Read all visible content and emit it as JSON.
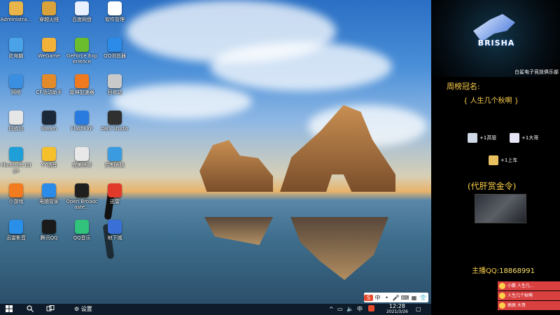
{
  "desktop_icons": [
    {
      "label": "Administra...",
      "color": "#e8b54a"
    },
    {
      "label": "穿越火线",
      "color": "#d9a23a"
    },
    {
      "label": "百度网盘",
      "color": "#e9f0ff"
    },
    {
      "label": "软件管理",
      "color": "#ffffff"
    },
    {
      "label": "此电脑",
      "color": "#4aa3e8"
    },
    {
      "label": "WeGame",
      "color": "#f2b23a"
    },
    {
      "label": "GeForce Experience",
      "color": "#6bbd2e"
    },
    {
      "label": "QQ浏览器",
      "color": "#2c8be8"
    },
    {
      "label": "网络",
      "color": "#3a8fe0"
    },
    {
      "label": "CF活动助手",
      "color": "#e38a2a"
    },
    {
      "label": "雷神加速器",
      "color": "#f07a1f"
    },
    {
      "label": "回收站",
      "color": "#c9c9c9"
    },
    {
      "label": "回收站",
      "color": "#e6e6e6"
    },
    {
      "label": "Steam",
      "color": "#1b2838"
    },
    {
      "label": "FlashFXP",
      "color": "#2a7be0"
    },
    {
      "label": "OBS Studio",
      "color": "#303030"
    },
    {
      "label": "Microsoft Edge",
      "color": "#1f9fd8"
    },
    {
      "label": "YY语音",
      "color": "#f5c02a"
    },
    {
      "label": "完美世界",
      "color": "#e8e8e8"
    },
    {
      "label": "控制面板",
      "color": "#3a9be0"
    },
    {
      "label": "小游戏",
      "color": "#f27b1f"
    },
    {
      "label": "电脑管家",
      "color": "#2a8be8"
    },
    {
      "label": "Open Broadcaste...",
      "color": "#1f1f1f"
    },
    {
      "label": "迅雷",
      "color": "#e23a2a"
    },
    {
      "label": "迅雷影音",
      "color": "#2a8fe8"
    },
    {
      "label": "腾讯QQ",
      "color": "#1a1a1a"
    },
    {
      "label": "QQ音乐",
      "color": "#31c27c"
    },
    {
      "label": "地下城",
      "color": "#3a6fd8"
    }
  ],
  "taskbar": {
    "start_icon": "windows-logo-icon",
    "search_icon": "search-icon",
    "taskview_icon": "task-view-icon",
    "settings_label": "设置",
    "tray_up": "^",
    "ime_lang": "中",
    "time": "12:28",
    "date": "2021/3/26"
  },
  "ime_bar": {
    "items": [
      "S",
      "中",
      "•",
      "🎤",
      "⌨",
      "▦",
      "👕"
    ]
  },
  "side_panel": {
    "club_name": "白鲨电子竞技俱乐部",
    "brand": "BRISHA",
    "weekly_title": "周榜冠名:",
    "weekly_name": "{ 人生几个秋啊 }",
    "awards": [
      {
        "label": "+1高管",
        "color": "#cfd8e6"
      },
      {
        "label": "+1大哥",
        "color": "#e6e6f8"
      },
      {
        "label": "+1上车",
        "color": "#e8c060"
      }
    ],
    "bounty_title": "(代肝赏金令)",
    "qq_label": "主播QQ:",
    "qq_number": "18868991"
  },
  "notifications": [
    {
      "text": "小鹏 人生几..."
    },
    {
      "text": "人生几个秋啊"
    },
    {
      "text": "佩佩 大哥"
    }
  ]
}
